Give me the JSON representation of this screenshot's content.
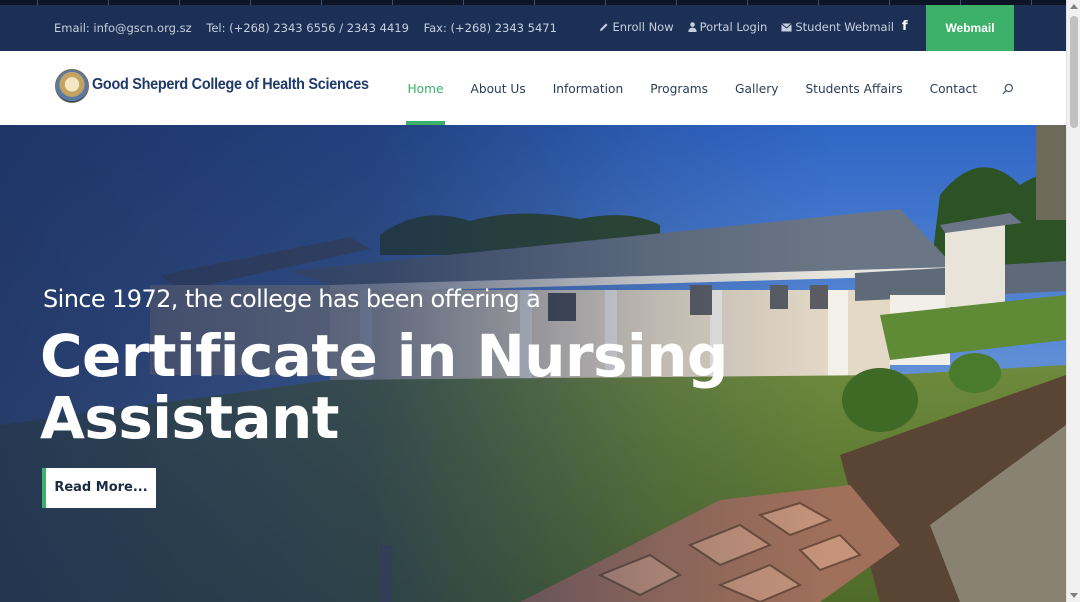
{
  "topbar": {
    "email": "Email: info@gscn.org.sz",
    "tel": "Tel: (+268) 2343 6556 / 2343 4419",
    "fax": "Fax: (+268) 2343 5471",
    "enroll": "Enroll Now",
    "portal": "Portal Login",
    "student_webmail": "Student Webmail",
    "facebook_icon": "facebook-icon",
    "webmail": "Webmail"
  },
  "brand": {
    "name": "Good Sheperd College of Health Sciences",
    "logo_icon": "college-crest-icon"
  },
  "nav": {
    "items": [
      {
        "label": "Home",
        "active": true
      },
      {
        "label": "About Us"
      },
      {
        "label": "Information"
      },
      {
        "label": "Programs"
      },
      {
        "label": "Gallery"
      },
      {
        "label": "Students Affairs"
      },
      {
        "label": "Contact"
      }
    ],
    "search_icon": "search-icon"
  },
  "hero": {
    "subtitle": "Since 1972, the college has been offering a",
    "title": "Certificate in Nursing Assistant",
    "button": "Read More..."
  },
  "colors": {
    "topbar_bg": "#1c3056",
    "accent_green": "#3db16a",
    "nav_text": "#2c3c55",
    "brand_blue": "#1f3a6a"
  }
}
